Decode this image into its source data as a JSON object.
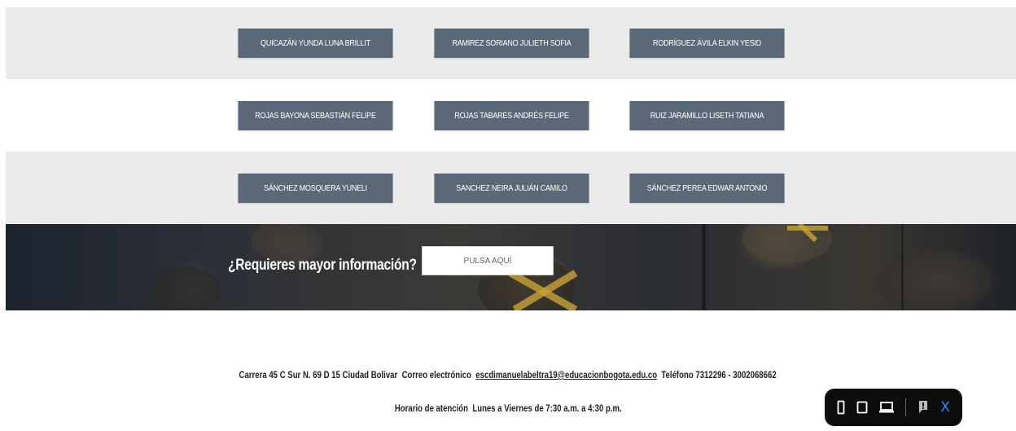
{
  "students": {
    "row1": [
      "QUICAZÁN YUNDA LUNA BRILLIT",
      "RAMIREZ SORIANO JULIETH SOFIA",
      "RODRÍGUEZ ÁVILA ELKIN YESID"
    ],
    "row2": [
      "ROJAS BAYONA SEBASTIÁN FELIPE",
      "ROJAS TABARES ANDRÉS FELIPE",
      "RUIZ JARAMILLO LISETH TATIANA"
    ],
    "row3": [
      "SÁNCHEZ MOSQUERA YUNELI",
      "SANCHEZ NEIRA JULIÁN CAMILO",
      "SÁNCHEZ PEREA EDWAR ANTONIO"
    ]
  },
  "banner": {
    "title": "¿Requieres mayor información?",
    "button_label": "PULSA AQUÍ"
  },
  "footer": {
    "address": "Carrera 45 C Sur N. 69 D 15  Ciudad Bolivar",
    "email_label": "Correo electrónico",
    "email": "escdimanuelabeltra19@educacionbogota.edu.co",
    "phone_label": "Teléfono",
    "phone": "7312296 - 3002068662",
    "hours_label": "Horario de atención",
    "hours": "Lunes a Viernes de 7:30 a.m. a 4:30 p.m."
  },
  "toolbar": {
    "icons": [
      "phone-view-icon",
      "tablet-view-icon",
      "desktop-view-icon",
      "comment-icon"
    ],
    "close_label": "X",
    "colors": {
      "background": "#0d0d0d",
      "close": "#2f8cff"
    }
  },
  "colors": {
    "button_bg": "#5b6877",
    "band_grey": "#ebebeb"
  }
}
